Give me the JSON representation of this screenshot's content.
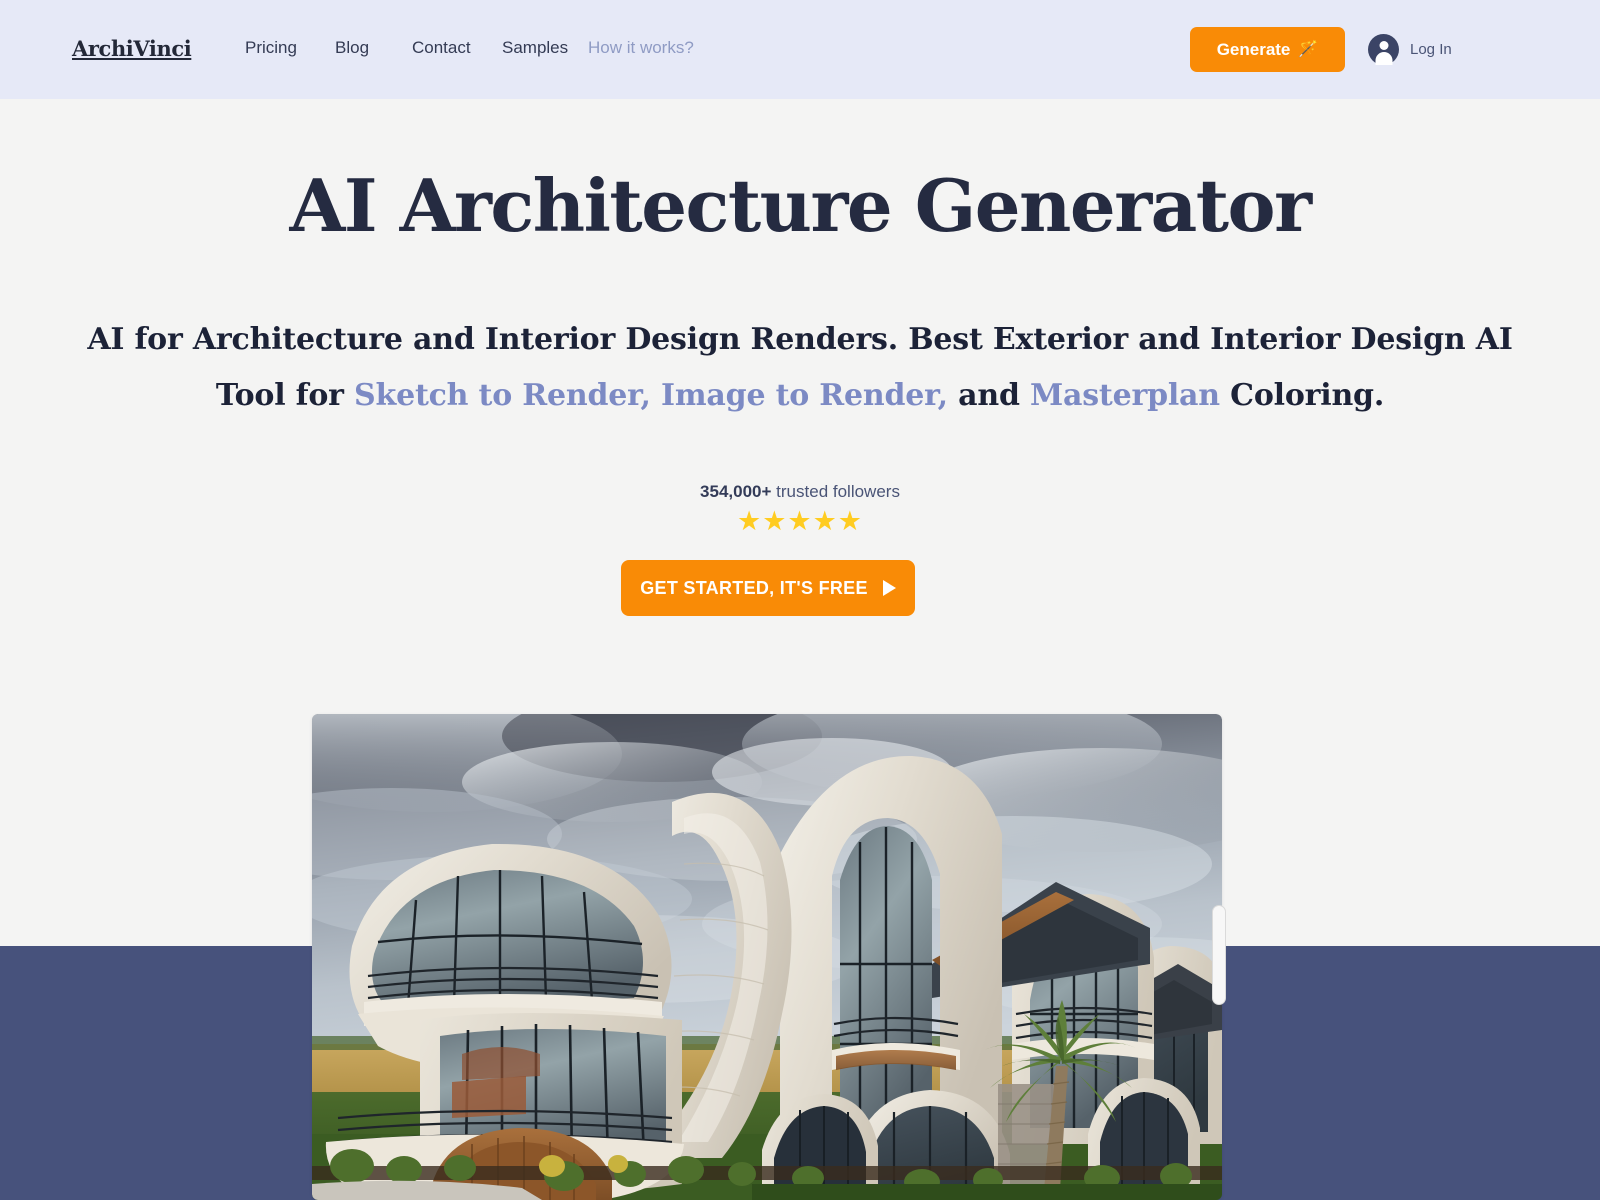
{
  "header": {
    "brand": "ArchiVinci",
    "nav": [
      {
        "label": "Pricing",
        "muted": false
      },
      {
        "label": "Blog",
        "muted": false
      },
      {
        "label": "Contact",
        "muted": false
      },
      {
        "label": "Samples",
        "muted": false
      },
      {
        "label": "How it works?",
        "muted": true
      }
    ],
    "generate_button": {
      "label": "Generate",
      "icon": "magic-wand-icon",
      "glyph": "🪄",
      "bg": "#F98B06"
    },
    "login": {
      "label": "Log In",
      "avatar_icon": "user-avatar-icon"
    },
    "bg": "#E6E9F7"
  },
  "hero": {
    "title": "AI Architecture Generator",
    "subtitle_parts": [
      {
        "text": "AI for Architecture and Interior Design Renders. Best Exterior and Interior Design AI Tool for ",
        "accent": false
      },
      {
        "text": "Sketch to Render, Image to Render,",
        "accent": true
      },
      {
        "text": " and ",
        "accent": false
      },
      {
        "text": "Masterplan",
        "accent": true
      },
      {
        "text": " Coloring.",
        "accent": false
      }
    ],
    "subtitle_plain": "AI for Architecture and Interior Design Renders. Best Exterior and Interior Design AI Tool for Sketch to Render, Image to Render, and Masterplan Coloring.",
    "accent_color": "#7C8AC4",
    "title_color": "#252B41"
  },
  "social_proof": {
    "count": "354,000+",
    "text": "trusted followers",
    "stars": "★★★★★",
    "star_count": 5,
    "star_color": "#FFCC21"
  },
  "cta": {
    "label": "GET STARTED, IT'S FREE",
    "icon": "play-arrow-icon",
    "bg": "#F98B06"
  },
  "hero_image": {
    "alt": "Modern curvilinear white concrete mansion with large arched glass windows, balconies and a palm tree under a dramatic cloudy sky",
    "scrollbar": "vertical-scrollbar-thumb"
  },
  "bottom_band": {
    "color": "#47527C"
  }
}
